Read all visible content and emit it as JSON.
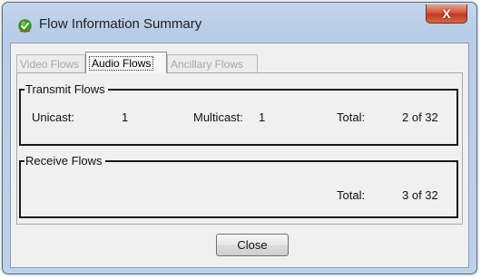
{
  "window": {
    "title": "Flow Information Summary",
    "close_glyph": "X"
  },
  "tabs": [
    {
      "label": "Video Flows",
      "active": false
    },
    {
      "label": "Audio Flows",
      "active": true
    },
    {
      "label": "Ancillary Flows",
      "active": false
    }
  ],
  "transmit": {
    "title": "Transmit Flows",
    "unicast_label": "Unicast:",
    "unicast_value": "1",
    "multicast_label": "Multicast:",
    "multicast_value": "1",
    "total_label": "Total:",
    "total_value": "2 of 32"
  },
  "receive": {
    "title": "Receive Flows",
    "total_label": "Total:",
    "total_value": "3 of 32"
  },
  "buttons": {
    "close_label": "Close"
  },
  "colors": {
    "app_icon_green": "#3f9e1f",
    "close_red": "#c1381f"
  },
  "icons": {
    "app": "green-check-icon",
    "close": "close-icon"
  }
}
